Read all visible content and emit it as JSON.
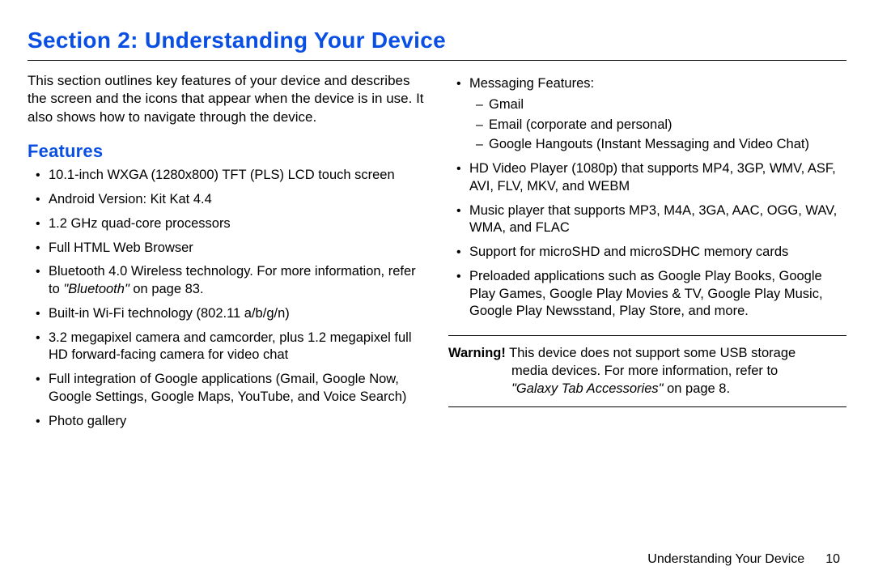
{
  "section_title": "Section 2: Understanding Your Device",
  "intro": "This section outlines key features of your device and describes the screen and the icons that appear when the device is in use. It also shows how to navigate through the device.",
  "features_heading": "Features",
  "col_left": {
    "f0": "10.1-inch WXGA (1280x800) TFT (PLS) LCD touch screen",
    "f1": "Android Version: Kit Kat 4.4",
    "f2": "1.2 GHz quad-core processors",
    "f3": "Full HTML Web Browser",
    "f4_pre": "Bluetooth 4.0 Wireless technology. For more information, refer to ",
    "f4_ref": "\"Bluetooth\"",
    "f4_post": " on page 83.",
    "f5": "Built-in Wi-Fi technology (802.11 a/b/g/n)",
    "f6": "3.2 megapixel camera and camcorder, plus 1.2 megapixel full HD forward-facing camera for video chat",
    "f7": "Full integration of Google applications (Gmail, Google Now, Google Settings, Google Maps, YouTube, and Voice Search)",
    "f8": "Photo gallery"
  },
  "col_right": {
    "r0_title": "Messaging Features:",
    "r0_sub0": "Gmail",
    "r0_sub1": "Email (corporate and personal)",
    "r0_sub2": "Google Hangouts (Instant Messaging and Video Chat)",
    "r1": "HD Video Player (1080p) that supports MP4, 3GP, WMV, ASF, AVI, FLV, MKV, and WEBM",
    "r2": "Music player that supports MP3, M4A, 3GA, AAC, OGG, WAV, WMA, and FLAC",
    "r3": "Support for microSHD and microSDHC memory cards",
    "r4": "Preloaded applications such as Google Play Books, Google Play Games, Google Play Movies & TV, Google Play Music, Google Play Newsstand, Play Store, and more."
  },
  "warning": {
    "label": "Warning!",
    "body_line1": " This device does not support some USB storage",
    "body_line2": "media devices. For more information, refer to ",
    "ref": "\"Galaxy Tab Accessories\"",
    "ref_post": " on page 8."
  },
  "footer": {
    "title": "Understanding Your Device",
    "page": "10"
  }
}
